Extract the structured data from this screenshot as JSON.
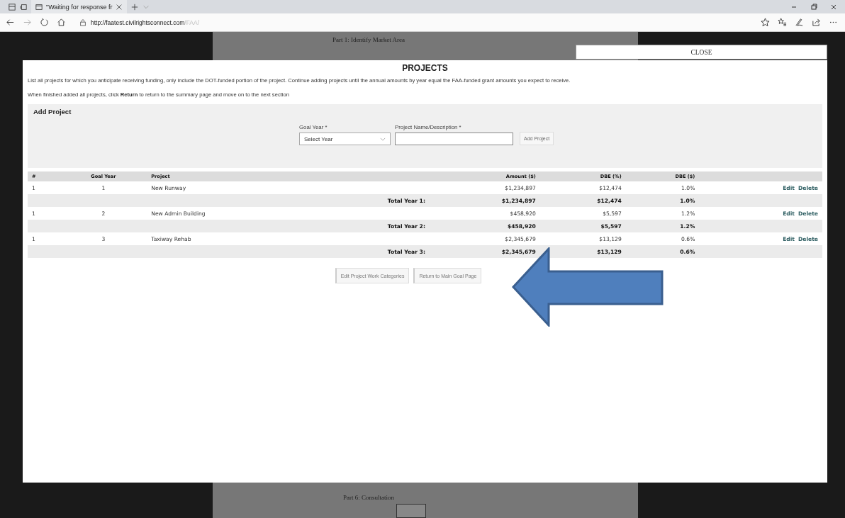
{
  "browser": {
    "tab_title": "\"Waiting for response fr",
    "url_host": "http://faatest.civilrightsconnect.com",
    "url_path": "/FAA/"
  },
  "background": {
    "top_heading": "Part 1: Identify Market Area",
    "bottom_heading": "Part 6: Consultation"
  },
  "close_button": "CLOSE",
  "modal": {
    "title": "PROJECTS",
    "instructions": [
      "List all projects for which you anticipate receiving funding, only include the DOT-funded portion of the project. Continue adding projects until the annual amounts by year equal the FAA-funded grant amounts you expect to receive.",
      "When finished added all projects, click **Return** to return to the summary page and move on to the next section"
    ],
    "add_project": {
      "heading": "Add Project",
      "goal_year_label": "Goal Year *",
      "goal_year_placeholder": "Select Year",
      "name_label": "Project Name/Description *",
      "add_button": "Add Project"
    },
    "table": {
      "columns": [
        "#",
        "Goal Year",
        "Project",
        "Amount ($)",
        "DBE (%)",
        "DBE ($)"
      ],
      "rows": [
        {
          "kind": "project",
          "number": "1",
          "goal_year": "1",
          "project": "New Runway",
          "amount": "$1,234,897",
          "dbe_pct": "$12,474",
          "dbe_amt": "1.0%",
          "actions": [
            "Edit",
            "Delete"
          ]
        },
        {
          "kind": "total",
          "label": "Total Year 1:",
          "amount": "$1,234,897",
          "dbe_pct": "$12,474",
          "dbe_amt": "1.0%"
        },
        {
          "kind": "project",
          "number": "1",
          "goal_year": "2",
          "project": "New Admin Building",
          "amount": "$458,920",
          "dbe_pct": "$5,597",
          "dbe_amt": "1.2%",
          "actions": [
            "Edit",
            "Delete"
          ]
        },
        {
          "kind": "total",
          "label": "Total Year 2:",
          "amount": "$458,920",
          "dbe_pct": "$5,597",
          "dbe_amt": "1.2%"
        },
        {
          "kind": "project",
          "number": "1",
          "goal_year": "3",
          "project": "Taxiway Rehab",
          "amount": "$2,345,679",
          "dbe_pct": "$13,129",
          "dbe_amt": "0.6%",
          "actions": [
            "Edit",
            "Delete"
          ]
        },
        {
          "kind": "total",
          "label": "Total Year 3:",
          "amount": "$2,345,679",
          "dbe_pct": "$13,129",
          "dbe_amt": "0.6%"
        }
      ]
    },
    "buttons": [
      "Edit Project Work Categories",
      "Return to Main Goal Page"
    ]
  }
}
